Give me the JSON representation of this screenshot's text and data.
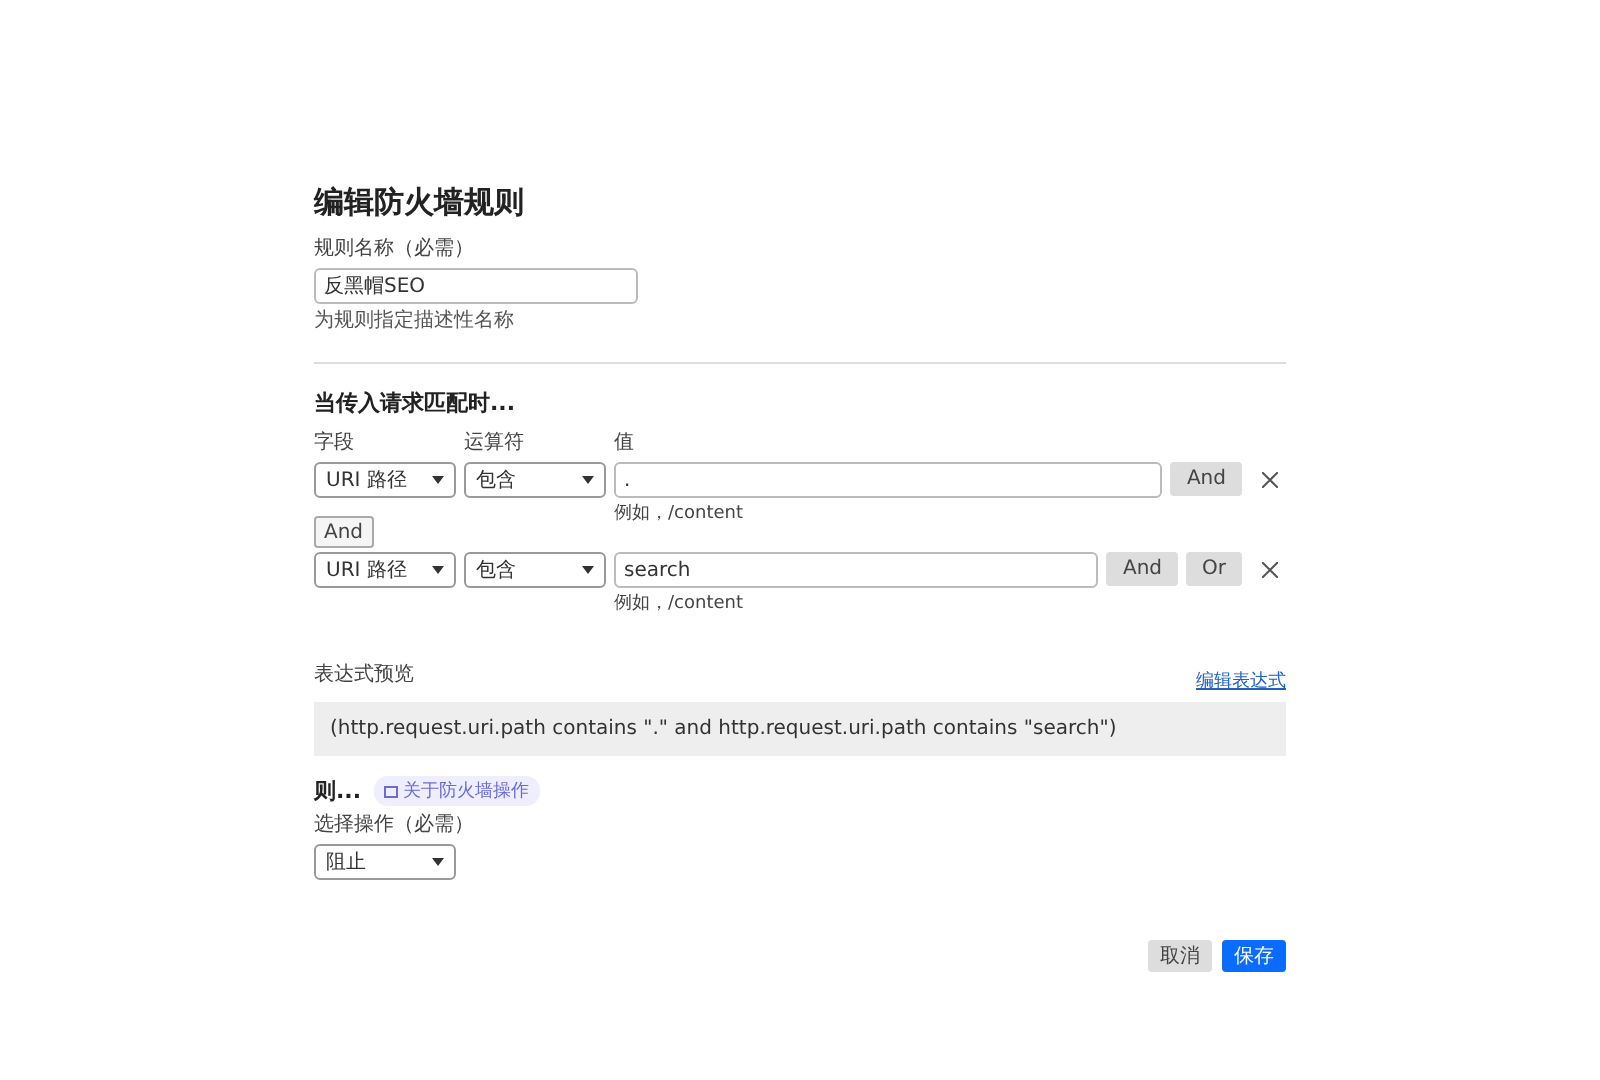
{
  "title": "编辑防火墙规则",
  "rule_name": {
    "label": "规则名称（必需）",
    "value": "反黑帽SEO",
    "hint": "为规则指定描述性名称"
  },
  "match": {
    "heading": "当传入请求匹配时...",
    "columns": [
      "字段",
      "运算符",
      "值"
    ],
    "rows": [
      {
        "field": "URI 路径",
        "operator": "包含",
        "value": ".",
        "example": "例如，/content",
        "buttons": [
          "And"
        ],
        "connector": "And"
      },
      {
        "field": "URI 路径",
        "operator": "包含",
        "value": "search",
        "example": "例如，/content",
        "buttons": [
          "And",
          "Or"
        ]
      }
    ]
  },
  "expression": {
    "label": "表达式预览",
    "link": "编辑表达式",
    "text": "(http.request.uri.path contains \".\" and http.request.uri.path contains \"search\")"
  },
  "then": {
    "heading": "则...",
    "badge": "关于防火墙操作",
    "action_label": "选择操作（必需）",
    "action": "阻止"
  },
  "buttons": [
    {
      "label": "取消",
      "kind": "secondary"
    },
    {
      "label": "保存",
      "kind": "primary"
    }
  ]
}
